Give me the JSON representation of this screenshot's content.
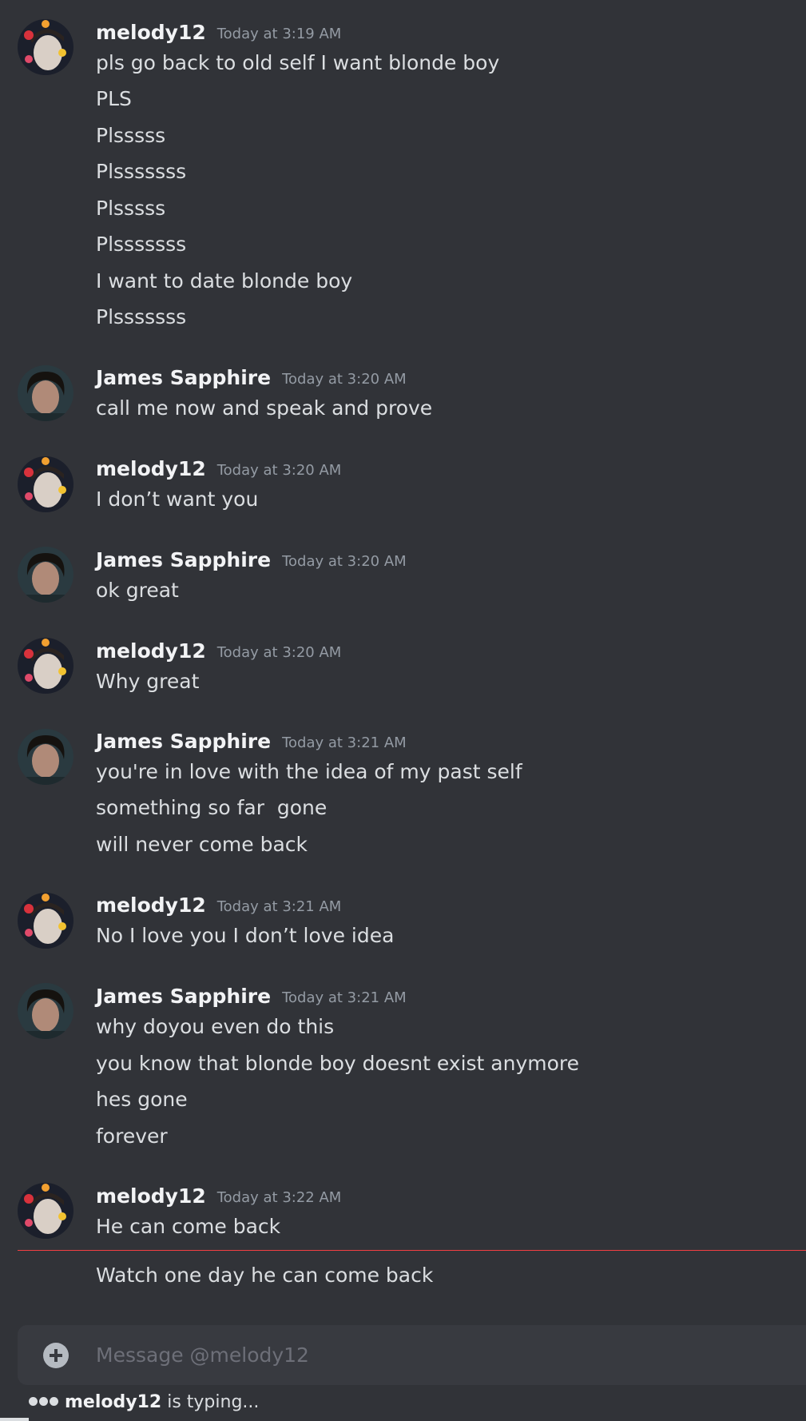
{
  "composer": {
    "placeholder": "Message @melody12"
  },
  "typing": {
    "user": "melody12",
    "suffix": " is typing..."
  },
  "messages": [
    {
      "author": "melody12",
      "timestamp": "Today at 3:19 AM",
      "lines": [
        "pls go back to old self I want blonde boy",
        "PLS",
        "Plsssss",
        "Plsssssss",
        "Plsssss",
        "Plsssssss",
        "I want to date blonde boy",
        "Plsssssss"
      ]
    },
    {
      "author": "James Sapphire",
      "timestamp": "Today at 3:20 AM",
      "lines": [
        "call me now and speak and prove"
      ]
    },
    {
      "author": "melody12",
      "timestamp": "Today at 3:20 AM",
      "lines": [
        "I don’t want you"
      ]
    },
    {
      "author": "James Sapphire",
      "timestamp": "Today at 3:20 AM",
      "lines": [
        "ok great"
      ]
    },
    {
      "author": "melody12",
      "timestamp": "Today at 3:20 AM",
      "lines": [
        "Why great"
      ]
    },
    {
      "author": "James Sapphire",
      "timestamp": "Today at 3:21 AM",
      "lines": [
        "you're in love with the idea of my past self",
        "something so far  gone",
        "will never come back"
      ]
    },
    {
      "author": "melody12",
      "timestamp": "Today at 3:21 AM",
      "lines": [
        "No I love you I don’t love idea"
      ]
    },
    {
      "author": "James Sapphire",
      "timestamp": "Today at 3:21 AM",
      "lines": [
        "why doyou even do this",
        "you know that blonde boy doesnt exist anymore",
        "hes gone",
        "forever"
      ]
    },
    {
      "author": "melody12",
      "timestamp": "Today at 3:22 AM",
      "lines": [
        "He can come back",
        "Watch one day he can come back"
      ]
    }
  ]
}
